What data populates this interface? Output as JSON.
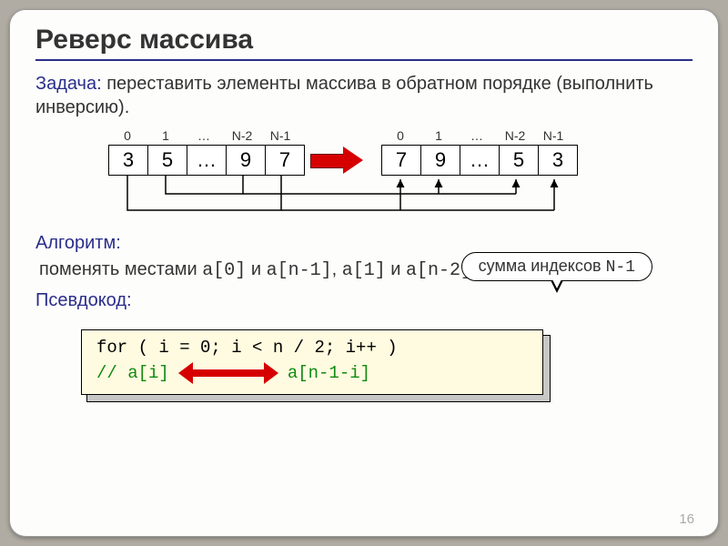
{
  "title": "Реверс массива",
  "task": {
    "label": "Задача:",
    "text": " переставить элементы массива в обратном порядке (выполнить инверсию)."
  },
  "diagram": {
    "indices": [
      "0",
      "1",
      "…",
      "N-2",
      "N-1"
    ],
    "before": [
      "3",
      "5",
      "…",
      "9",
      "7"
    ],
    "after": [
      "7",
      "9",
      "…",
      "5",
      "3"
    ]
  },
  "algorithm": {
    "label": "Алгоритм:",
    "line_p1": "поменять местами ",
    "line_m1": "a[0]",
    "line_p2": " и ",
    "line_m2": "a[n-1]",
    "line_p3": ", ",
    "line_m3": "a[1]",
    "line_p4": " и ",
    "line_m4": "a[n-2]",
    "line_p5": ",…"
  },
  "badge": {
    "text": "сумма индексов ",
    "code": "N-1"
  },
  "pseudocode": {
    "label": "Псевдокод:",
    "line1": "for ( i = 0; i < n / 2; i++ )",
    "line2_a": " // a[i]",
    "line2_b": "a[n-1-i]"
  },
  "page": "16"
}
